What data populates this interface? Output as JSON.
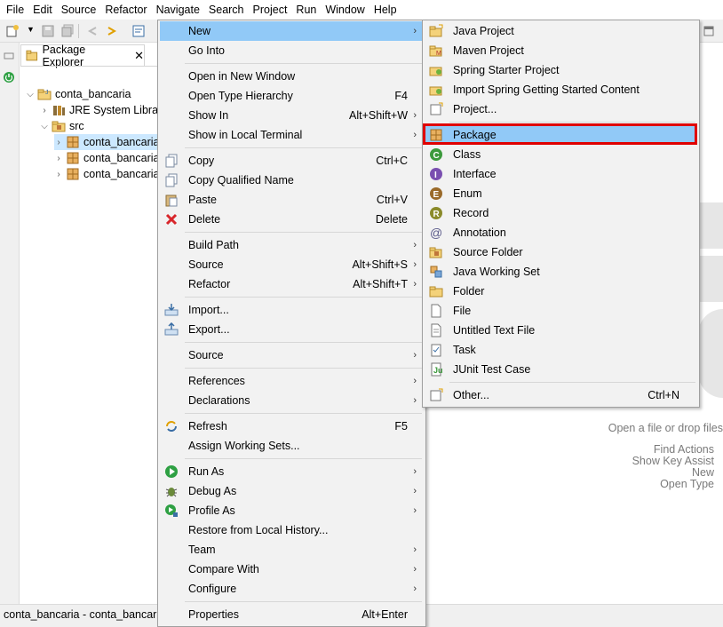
{
  "menubar": {
    "items": [
      "File",
      "Edit",
      "Source",
      "Refactor",
      "Navigate",
      "Search",
      "Project",
      "Run",
      "Window",
      "Help"
    ]
  },
  "explorer": {
    "tab_label": "Package Explorer",
    "close_glyph": "✕",
    "tree": [
      {
        "label": "conta_bancaria",
        "twisty": "⌵",
        "icon": "java-project-icon"
      },
      {
        "label": "JRE System Library",
        "twisty": "›",
        "icon": "library-icon"
      },
      {
        "label": "src",
        "twisty": "⌵",
        "icon": "source-folder-icon"
      },
      {
        "label": "conta_bancaria",
        "twisty": "›",
        "icon": "package-icon"
      },
      {
        "label": "conta_bancaria",
        "twisty": "›",
        "icon": "package-icon"
      },
      {
        "label": "conta_bancaria",
        "twisty": "›",
        "icon": "package-icon"
      }
    ]
  },
  "context_menu": {
    "items": {
      "new": {
        "label": "New",
        "arrow": "›"
      },
      "go_into": {
        "label": "Go Into"
      },
      "open_new_window": {
        "label": "Open in New Window"
      },
      "open_type_hierarchy": {
        "label": "Open Type Hierarchy",
        "shortcut": "F4"
      },
      "show_in": {
        "label": "Show In",
        "shortcut": "Alt+Shift+W",
        "arrow": "›"
      },
      "show_local_terminal": {
        "label": "Show in Local Terminal",
        "arrow": "›"
      },
      "copy": {
        "label": "Copy",
        "shortcut": "Ctrl+C"
      },
      "copy_qualified": {
        "label": "Copy Qualified Name"
      },
      "paste": {
        "label": "Paste",
        "shortcut": "Ctrl+V"
      },
      "delete": {
        "label": "Delete",
        "shortcut": "Delete"
      },
      "build_path": {
        "label": "Build Path",
        "arrow": "›"
      },
      "source": {
        "label": "Source",
        "shortcut": "Alt+Shift+S",
        "arrow": "›"
      },
      "refactor": {
        "label": "Refactor",
        "shortcut": "Alt+Shift+T",
        "arrow": "›"
      },
      "import": {
        "label": "Import..."
      },
      "export": {
        "label": "Export..."
      },
      "source2": {
        "label": "Source",
        "arrow": "›"
      },
      "references": {
        "label": "References",
        "arrow": "›"
      },
      "declarations": {
        "label": "Declarations",
        "arrow": "›"
      },
      "refresh": {
        "label": "Refresh",
        "shortcut": "F5"
      },
      "assign_working_sets": {
        "label": "Assign Working Sets..."
      },
      "run_as": {
        "label": "Run As",
        "arrow": "›"
      },
      "debug_as": {
        "label": "Debug As",
        "arrow": "›"
      },
      "profile_as": {
        "label": "Profile As",
        "arrow": "›"
      },
      "restore_history": {
        "label": "Restore from Local History..."
      },
      "team": {
        "label": "Team",
        "arrow": "›"
      },
      "compare_with": {
        "label": "Compare With",
        "arrow": "›"
      },
      "configure": {
        "label": "Configure",
        "arrow": "›"
      },
      "properties": {
        "label": "Properties",
        "shortcut": "Alt+Enter"
      }
    }
  },
  "new_submenu": {
    "items": {
      "java_project": {
        "label": "Java Project"
      },
      "maven_project": {
        "label": "Maven Project"
      },
      "spring_starter": {
        "label": "Spring Starter Project"
      },
      "import_spring": {
        "label": "Import Spring Getting Started Content"
      },
      "project": {
        "label": "Project..."
      },
      "package": {
        "label": "Package"
      },
      "class": {
        "label": "Class"
      },
      "interface": {
        "label": "Interface"
      },
      "enum": {
        "label": "Enum"
      },
      "record": {
        "label": "Record"
      },
      "annotation": {
        "label": "Annotation"
      },
      "source_folder": {
        "label": "Source Folder"
      },
      "java_working_set": {
        "label": "Java Working Set"
      },
      "folder": {
        "label": "Folder"
      },
      "file": {
        "label": "File"
      },
      "untitled_text": {
        "label": "Untitled Text File"
      },
      "task": {
        "label": "Task"
      },
      "junit": {
        "label": "JUnit Test Case"
      },
      "other": {
        "label": "Other...",
        "shortcut": "Ctrl+N"
      }
    }
  },
  "editor_hints": {
    "drop": "Open a file or drop files",
    "find_actions": "Find Actions",
    "show_key_assist": "Show Key Assist",
    "new": "New",
    "open_type": "Open Type"
  },
  "statusbar": {
    "text": "conta_bancaria - conta_bancaria/"
  },
  "colors": {
    "highlight": "#91c9f7",
    "annotation_box": "#e00000",
    "selection": "#cce8ff"
  }
}
